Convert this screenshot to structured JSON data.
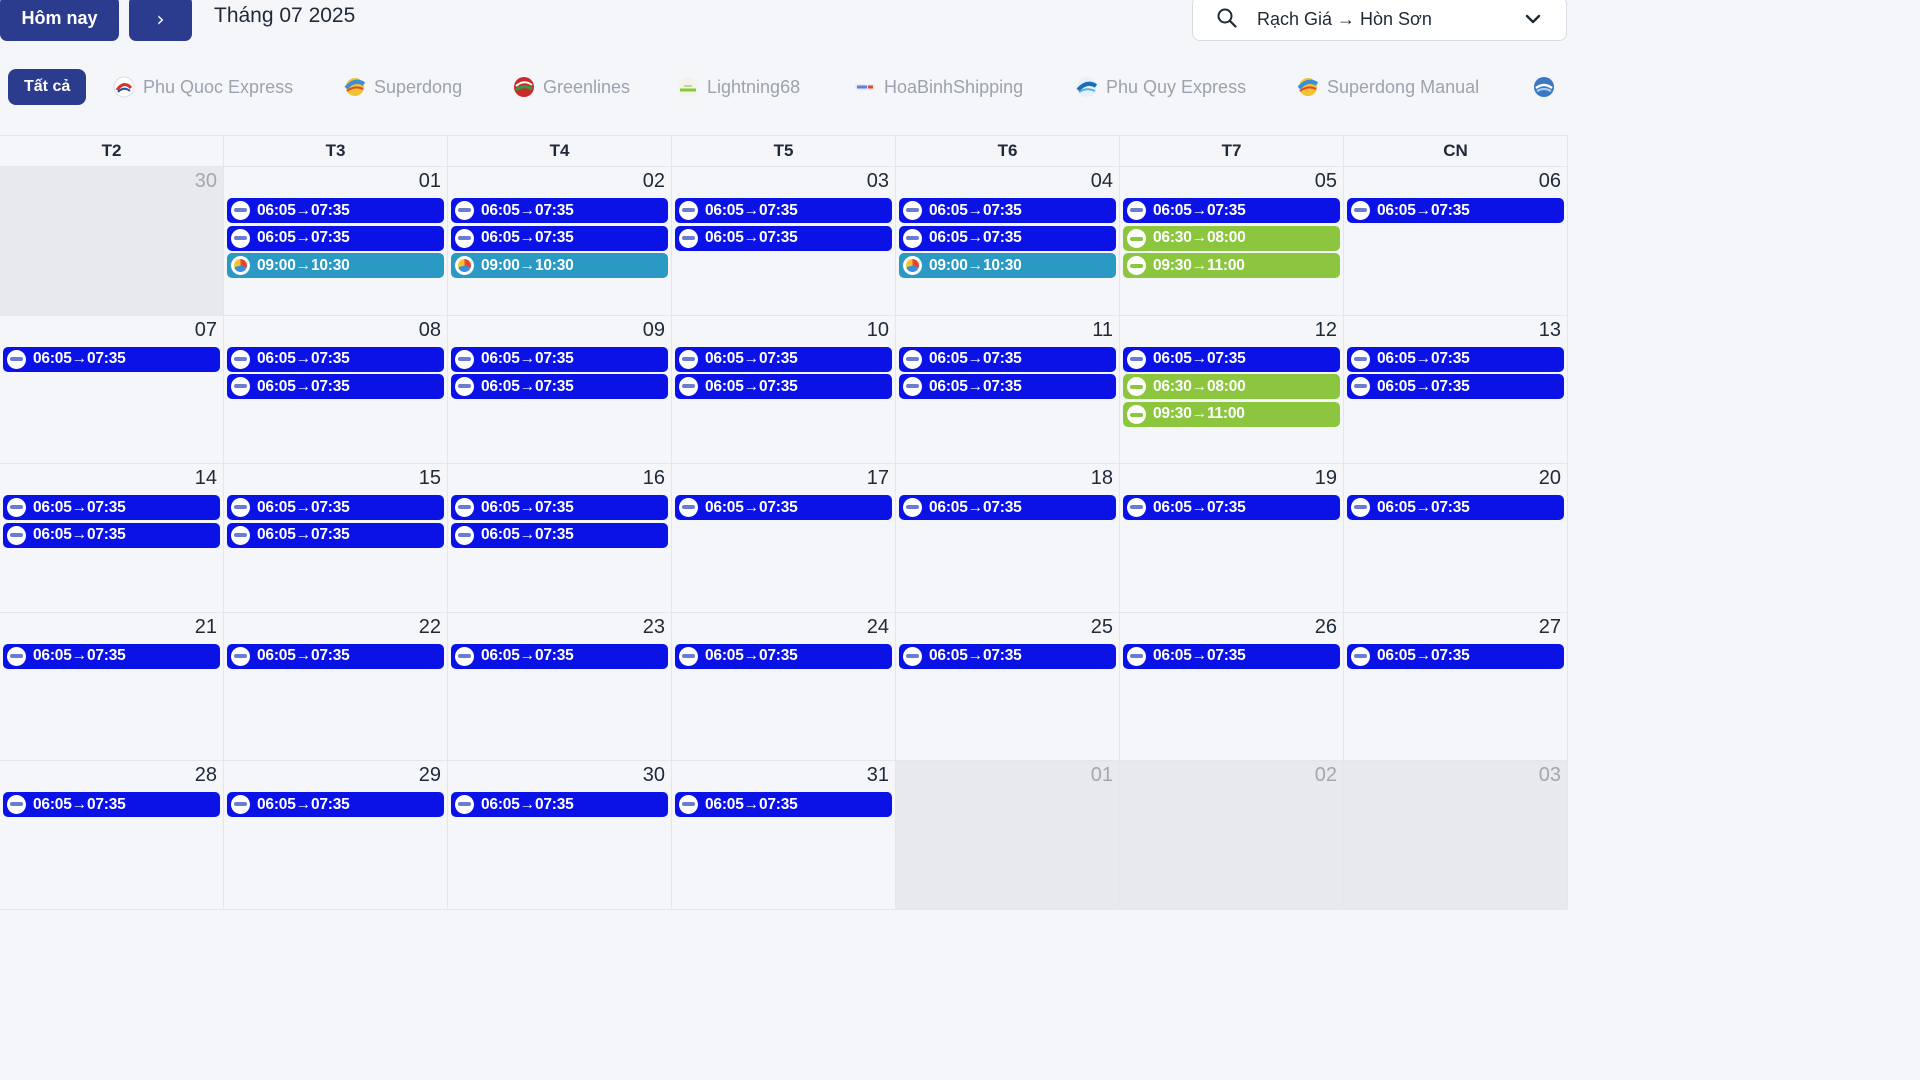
{
  "toolbar": {
    "today_label": "Hôm nay",
    "next_label": "›",
    "month_title": "Tháng 07 2025",
    "route_value": "Rạch Giá → Hòn Sơn"
  },
  "tabs": [
    {
      "label": "Tất cả",
      "active": true
    },
    {
      "label": "Phu Quoc Express",
      "icon": "phu-quoc-express-logo"
    },
    {
      "label": "Superdong",
      "icon": "superdong-logo"
    },
    {
      "label": "Greenlines",
      "icon": "greenlines-logo"
    },
    {
      "label": "Lightning68",
      "icon": "lightning68-logo"
    },
    {
      "label": "HoaBinhShipping",
      "icon": "hoabinh-logo"
    },
    {
      "label": "Phu Quy Express",
      "icon": "phu-quy-logo"
    },
    {
      "label": "Superdong Manual",
      "icon": "superdong-manual-logo"
    }
  ],
  "colors": {
    "primary": "#2b3c8f",
    "event_hoabinh": "#0a12e6",
    "event_superdong": "#2a9ac4",
    "event_lightning": "#8cc63f"
  },
  "days_of_week": [
    "T2",
    "T3",
    "T4",
    "T5",
    "T6",
    "T7",
    "CN"
  ],
  "weeks": [
    [
      {
        "day": "30",
        "outside": true,
        "events": []
      },
      {
        "day": "01",
        "events": [
          {
            "time": "06:05→07:35",
            "op": "hbs"
          },
          {
            "time": "06:05→07:35",
            "op": "hbs"
          },
          {
            "time": "09:00→10:30",
            "op": "sd"
          }
        ]
      },
      {
        "day": "02",
        "events": [
          {
            "time": "06:05→07:35",
            "op": "hbs"
          },
          {
            "time": "06:05→07:35",
            "op": "hbs"
          },
          {
            "time": "09:00→10:30",
            "op": "sd"
          }
        ]
      },
      {
        "day": "03",
        "events": [
          {
            "time": "06:05→07:35",
            "op": "hbs"
          },
          {
            "time": "06:05→07:35",
            "op": "hbs"
          }
        ]
      },
      {
        "day": "04",
        "events": [
          {
            "time": "06:05→07:35",
            "op": "hbs"
          },
          {
            "time": "06:05→07:35",
            "op": "hbs"
          },
          {
            "time": "09:00→10:30",
            "op": "sd"
          }
        ]
      },
      {
        "day": "05",
        "events": [
          {
            "time": "06:05→07:35",
            "op": "hbs"
          },
          {
            "time": "06:30→08:00",
            "op": "lt"
          },
          {
            "time": "09:30→11:00",
            "op": "lt"
          }
        ]
      },
      {
        "day": "06",
        "events": [
          {
            "time": "06:05→07:35",
            "op": "hbs"
          }
        ]
      }
    ],
    [
      {
        "day": "07",
        "events": [
          {
            "time": "06:05→07:35",
            "op": "hbs"
          }
        ]
      },
      {
        "day": "08",
        "events": [
          {
            "time": "06:05→07:35",
            "op": "hbs"
          },
          {
            "time": "06:05→07:35",
            "op": "hbs"
          }
        ]
      },
      {
        "day": "09",
        "events": [
          {
            "time": "06:05→07:35",
            "op": "hbs"
          },
          {
            "time": "06:05→07:35",
            "op": "hbs"
          }
        ]
      },
      {
        "day": "10",
        "events": [
          {
            "time": "06:05→07:35",
            "op": "hbs"
          },
          {
            "time": "06:05→07:35",
            "op": "hbs"
          }
        ]
      },
      {
        "day": "11",
        "events": [
          {
            "time": "06:05→07:35",
            "op": "hbs"
          },
          {
            "time": "06:05→07:35",
            "op": "hbs"
          }
        ]
      },
      {
        "day": "12",
        "events": [
          {
            "time": "06:05→07:35",
            "op": "hbs"
          },
          {
            "time": "06:30→08:00",
            "op": "lt"
          },
          {
            "time": "09:30→11:00",
            "op": "lt"
          }
        ]
      },
      {
        "day": "13",
        "events": [
          {
            "time": "06:05→07:35",
            "op": "hbs"
          },
          {
            "time": "06:05→07:35",
            "op": "hbs"
          }
        ]
      }
    ],
    [
      {
        "day": "14",
        "events": [
          {
            "time": "06:05→07:35",
            "op": "hbs"
          },
          {
            "time": "06:05→07:35",
            "op": "hbs"
          }
        ]
      },
      {
        "day": "15",
        "events": [
          {
            "time": "06:05→07:35",
            "op": "hbs"
          },
          {
            "time": "06:05→07:35",
            "op": "hbs"
          }
        ]
      },
      {
        "day": "16",
        "events": [
          {
            "time": "06:05→07:35",
            "op": "hbs"
          },
          {
            "time": "06:05→07:35",
            "op": "hbs"
          }
        ]
      },
      {
        "day": "17",
        "events": [
          {
            "time": "06:05→07:35",
            "op": "hbs"
          }
        ]
      },
      {
        "day": "18",
        "events": [
          {
            "time": "06:05→07:35",
            "op": "hbs"
          }
        ]
      },
      {
        "day": "19",
        "events": [
          {
            "time": "06:05→07:35",
            "op": "hbs"
          }
        ]
      },
      {
        "day": "20",
        "events": [
          {
            "time": "06:05→07:35",
            "op": "hbs"
          }
        ]
      }
    ],
    [
      {
        "day": "21",
        "events": [
          {
            "time": "06:05→07:35",
            "op": "hbs"
          }
        ]
      },
      {
        "day": "22",
        "events": [
          {
            "time": "06:05→07:35",
            "op": "hbs"
          }
        ]
      },
      {
        "day": "23",
        "events": [
          {
            "time": "06:05→07:35",
            "op": "hbs"
          }
        ]
      },
      {
        "day": "24",
        "events": [
          {
            "time": "06:05→07:35",
            "op": "hbs"
          }
        ]
      },
      {
        "day": "25",
        "events": [
          {
            "time": "06:05→07:35",
            "op": "hbs"
          }
        ]
      },
      {
        "day": "26",
        "events": [
          {
            "time": "06:05→07:35",
            "op": "hbs"
          }
        ]
      },
      {
        "day": "27",
        "events": [
          {
            "time": "06:05→07:35",
            "op": "hbs"
          }
        ]
      }
    ],
    [
      {
        "day": "28",
        "events": [
          {
            "time": "06:05→07:35",
            "op": "hbs"
          }
        ]
      },
      {
        "day": "29",
        "events": [
          {
            "time": "06:05→07:35",
            "op": "hbs"
          }
        ]
      },
      {
        "day": "30",
        "events": [
          {
            "time": "06:05→07:35",
            "op": "hbs"
          }
        ]
      },
      {
        "day": "31",
        "events": [
          {
            "time": "06:05→07:35",
            "op": "hbs"
          }
        ]
      },
      {
        "day": "01",
        "outside": true,
        "events": []
      },
      {
        "day": "02",
        "outside": true,
        "events": []
      },
      {
        "day": "03",
        "outside": true,
        "events": []
      }
    ]
  ]
}
